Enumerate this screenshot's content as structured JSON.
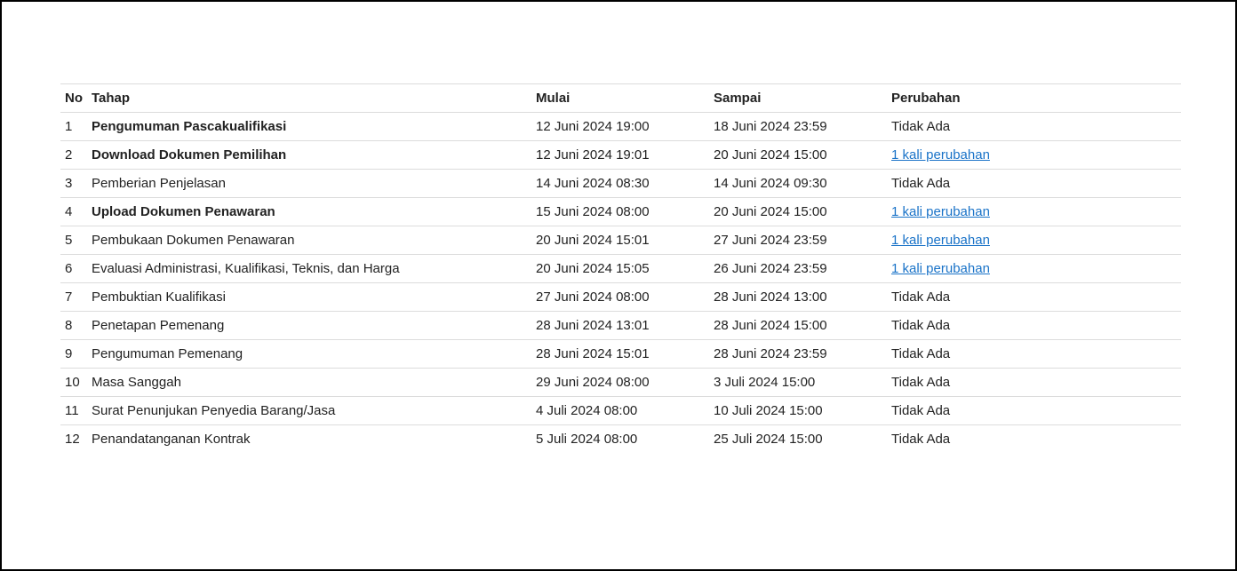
{
  "table": {
    "headers": {
      "no": "No",
      "tahap": "Tahap",
      "mulai": "Mulai",
      "sampai": "Sampai",
      "perubahan": "Perubahan"
    },
    "rows": [
      {
        "no": "1",
        "tahap": "Pengumuman Pascakualifikasi",
        "bold": true,
        "mulai": "12 Juni 2024 19:00",
        "sampai": "18 Juni 2024 23:59",
        "perubahan": "Tidak Ada",
        "is_link": false
      },
      {
        "no": "2",
        "tahap": "Download Dokumen Pemilihan",
        "bold": true,
        "mulai": "12 Juni 2024 19:01",
        "sampai": "20 Juni 2024 15:00",
        "perubahan": "1 kali perubahan",
        "is_link": true
      },
      {
        "no": "3",
        "tahap": "Pemberian Penjelasan",
        "bold": false,
        "mulai": "14 Juni 2024 08:30",
        "sampai": "14 Juni 2024 09:30",
        "perubahan": "Tidak Ada",
        "is_link": false
      },
      {
        "no": "4",
        "tahap": "Upload Dokumen Penawaran",
        "bold": true,
        "mulai": "15 Juni 2024 08:00",
        "sampai": "20 Juni 2024 15:00",
        "perubahan": "1 kali perubahan",
        "is_link": true
      },
      {
        "no": "5",
        "tahap": "Pembukaan Dokumen Penawaran",
        "bold": false,
        "mulai": "20 Juni 2024 15:01",
        "sampai": "27 Juni 2024 23:59",
        "perubahan": "1 kali perubahan",
        "is_link": true
      },
      {
        "no": "6",
        "tahap": "Evaluasi Administrasi, Kualifikasi, Teknis, dan Harga",
        "bold": false,
        "mulai": "20 Juni 2024 15:05",
        "sampai": "26 Juni 2024 23:59",
        "perubahan": "1 kali perubahan",
        "is_link": true
      },
      {
        "no": "7",
        "tahap": "Pembuktian Kualifikasi",
        "bold": false,
        "mulai": "27 Juni 2024 08:00",
        "sampai": "28 Juni 2024 13:00",
        "perubahan": "Tidak Ada",
        "is_link": false
      },
      {
        "no": "8",
        "tahap": "Penetapan Pemenang",
        "bold": false,
        "mulai": "28 Juni 2024 13:01",
        "sampai": "28 Juni 2024 15:00",
        "perubahan": "Tidak Ada",
        "is_link": false
      },
      {
        "no": "9",
        "tahap": "Pengumuman Pemenang",
        "bold": false,
        "mulai": "28 Juni 2024 15:01",
        "sampai": "28 Juni 2024 23:59",
        "perubahan": "Tidak Ada",
        "is_link": false
      },
      {
        "no": "10",
        "tahap": "Masa Sanggah",
        "bold": false,
        "mulai": "29 Juni 2024 08:00",
        "sampai": "3 Juli 2024 15:00",
        "perubahan": "Tidak Ada",
        "is_link": false
      },
      {
        "no": "11",
        "tahap": "Surat Penunjukan Penyedia Barang/Jasa",
        "bold": false,
        "mulai": "4 Juli 2024 08:00",
        "sampai": "10 Juli 2024 15:00",
        "perubahan": "Tidak Ada",
        "is_link": false
      },
      {
        "no": "12",
        "tahap": "Penandatanganan Kontrak",
        "bold": false,
        "mulai": "5 Juli 2024 08:00",
        "sampai": "25 Juli 2024 15:00",
        "perubahan": "Tidak Ada",
        "is_link": false
      }
    ]
  },
  "colors": {
    "link": "#1a73c8",
    "border": "#dcdcdc",
    "text": "#222222"
  }
}
